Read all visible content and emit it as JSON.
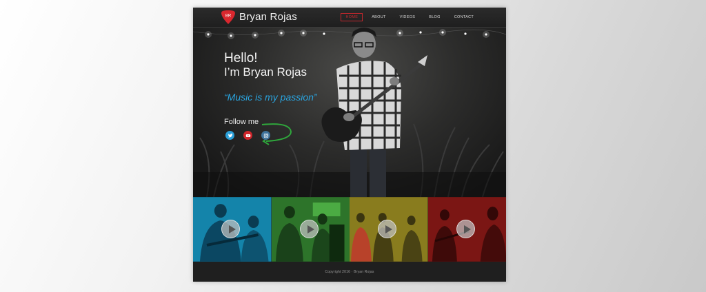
{
  "header": {
    "logo_text": "BR",
    "brand": "Bryan Rojas",
    "nav": [
      {
        "label": "HOME",
        "active": true
      },
      {
        "label": "ABOUT",
        "active": false
      },
      {
        "label": "VIDEOS",
        "active": false
      },
      {
        "label": "BLOG",
        "active": false
      },
      {
        "label": "CONTACT",
        "active": false
      }
    ]
  },
  "hero": {
    "greeting": "Hello!",
    "intro": "I’m Bryan Rojas",
    "tagline": "“Music is my passion”",
    "follow_label": "Follow me",
    "social": [
      {
        "icon": "twitter-icon",
        "color": "#2a9fd8"
      },
      {
        "icon": "youtube-icon",
        "color": "#d0262b"
      },
      {
        "icon": "instagram-icon",
        "color": "#3f729b"
      }
    ]
  },
  "videos": [
    {
      "tint": "#1aa6d4",
      "icon": "play-icon"
    },
    {
      "tint": "#3fa53a",
      "icon": "play-icon"
    },
    {
      "tint": "#b7a528",
      "icon": "play-icon"
    },
    {
      "tint": "#b3221f",
      "icon": "play-icon"
    }
  ],
  "footer": {
    "copyright": "Copyright 2016  ·  Bryan Rojas"
  },
  "colors": {
    "accent_red": "#c2272d",
    "tagline_blue": "#2aa4df",
    "arrow_green": "#2fa83c"
  }
}
